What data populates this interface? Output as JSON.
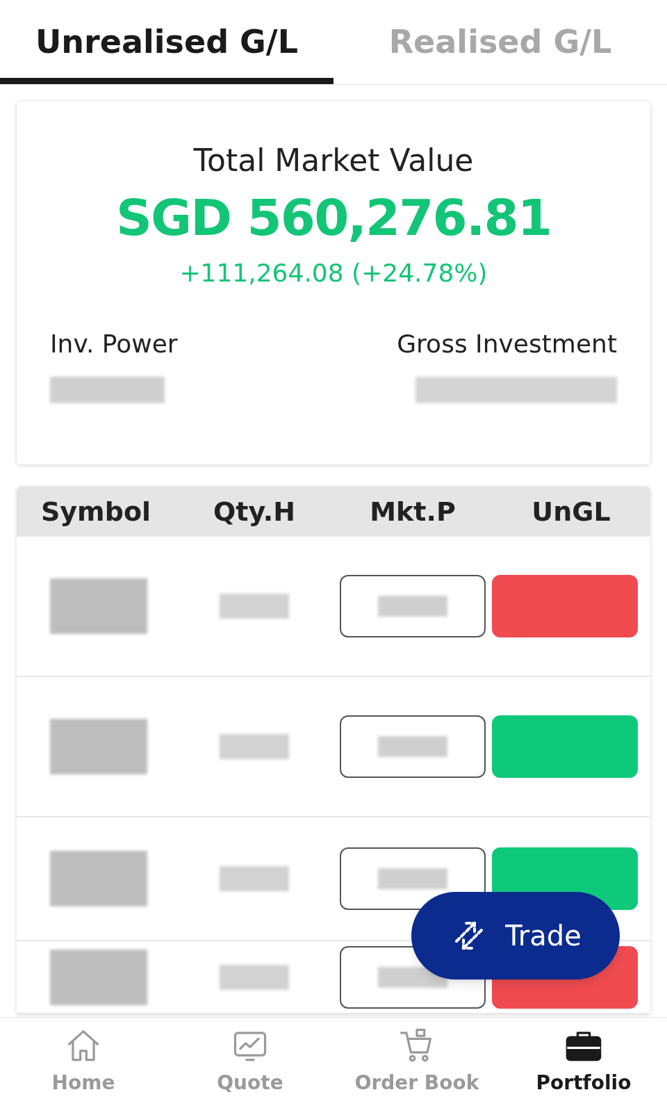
{
  "tabs": [
    {
      "label": "Unrealised G/L",
      "selected": true
    },
    {
      "label": "Realised G/L",
      "selected": false
    }
  ],
  "summary": {
    "title": "Total Market Value",
    "value": "SGD 560,276.81",
    "change": "+111,264.08 (+24.78%)",
    "inv_power_label": "Inv. Power",
    "gross_investment_label": "Gross Investment"
  },
  "table": {
    "columns": [
      "Symbol",
      "Qty.H",
      "Mkt.P",
      "UnGL"
    ],
    "rows": [
      {
        "color": "#f04b4f"
      },
      {
        "color": "#0fc97a"
      },
      {
        "color": "#0fc97a"
      },
      {
        "color": "#f04b4f"
      }
    ]
  },
  "trade_button": {
    "label": "Trade"
  },
  "nav": [
    {
      "label": "Home",
      "selected": false,
      "kind": "home"
    },
    {
      "label": "Quote",
      "selected": false,
      "kind": "chart"
    },
    {
      "label": "Order Book",
      "selected": false,
      "kind": "cart"
    },
    {
      "label": "Portfolio",
      "selected": true,
      "kind": "briefcase"
    }
  ]
}
